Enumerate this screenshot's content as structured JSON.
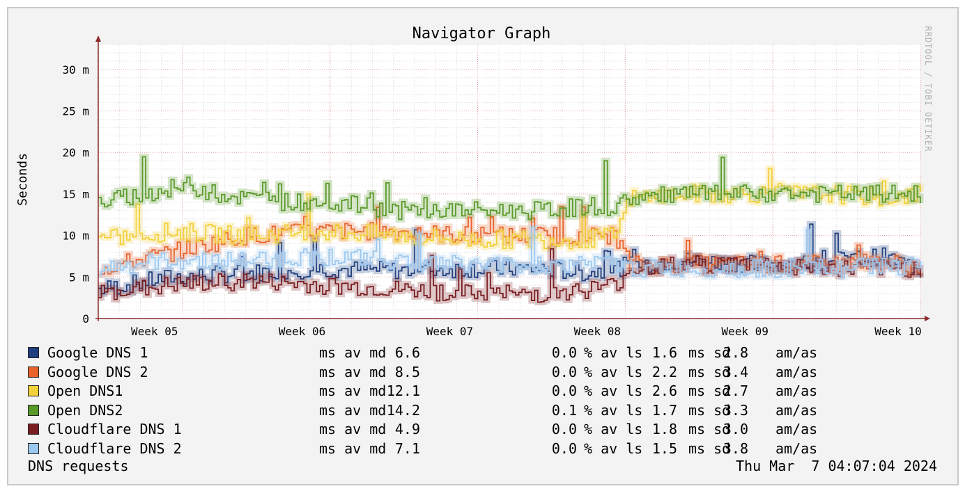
{
  "chart_data": {
    "type": "line",
    "title": "Navigator Graph",
    "ylabel": "Seconds",
    "xlabel": "",
    "watermark": "RRDTOOL / TOBI OETIKER",
    "y_ticks": [
      "0",
      "5 m",
      "10 m",
      "15 m",
      "20 m",
      "25 m",
      "30 m"
    ],
    "y_tick_values": [
      0,
      5,
      10,
      15,
      20,
      25,
      30
    ],
    "ylim": [
      0,
      33
    ],
    "y_unit": "ms",
    "x_ticks": [
      "Week 05",
      "Week 06",
      "Week 07",
      "Week 08",
      "Week 09",
      "Week 10"
    ],
    "x_tick_values": [
      0.57,
      1.57,
      2.57,
      3.57,
      4.57,
      5.57
    ],
    "xlim": [
      0,
      5.57
    ],
    "grid": true,
    "series": [
      {
        "name": "Google DNS 1",
        "color": "#1f3f7f",
        "x": [
          0,
          0.5,
          1,
          1.5,
          2,
          2.5,
          3,
          3.3,
          3.5,
          3.6,
          4,
          4.5,
          5,
          5.3,
          5.57
        ],
        "values": [
          3.5,
          5,
          5.5,
          6,
          5.8,
          6,
          6,
          5.5,
          6,
          6.5,
          7,
          6.5,
          7,
          7.5,
          6
        ]
      },
      {
        "name": "Google DNS 2",
        "color": "#e8622a",
        "x": [
          0,
          0.5,
          1,
          1.5,
          2,
          2.5,
          3,
          3.3,
          3.5,
          3.6,
          4,
          4.5,
          5,
          5.3,
          5.57
        ],
        "values": [
          6,
          8,
          10,
          10.5,
          10.5,
          10,
          10,
          10,
          10,
          6.5,
          6.5,
          6.5,
          6.5,
          7,
          6
        ]
      },
      {
        "name": "Open DNS1",
        "color": "#f2d13a",
        "x": [
          0,
          0.5,
          1,
          1.5,
          2,
          2.5,
          3,
          3.3,
          3.5,
          3.6,
          4,
          4.5,
          5,
          5.3,
          5.57
        ],
        "values": [
          9.5,
          10.5,
          10,
          10.5,
          10,
          9.5,
          9.5,
          9.5,
          10,
          14.5,
          15,
          15,
          15,
          14.5,
          15
        ]
      },
      {
        "name": "Open DNS2",
        "color": "#5a9a2a",
        "x": [
          0,
          0.3,
          0.6,
          0.8,
          1,
          1.3,
          1.6,
          2,
          2.5,
          3,
          3.3,
          3.5,
          3.6,
          4,
          4.5,
          5,
          5.3,
          5.57
        ],
        "values": [
          14,
          15,
          16,
          15,
          14.5,
          14,
          14,
          13,
          13,
          13,
          13.5,
          13.5,
          14.5,
          15,
          15,
          15,
          15,
          15
        ]
      },
      {
        "name": "Cloudflare DNS 1",
        "color": "#7a1e22",
        "x": [
          0,
          0.5,
          1,
          1.5,
          2,
          2.5,
          3,
          3.3,
          3.5,
          3.6,
          4,
          4.5,
          5,
          5.3,
          5.57
        ],
        "values": [
          3,
          4,
          4.5,
          4,
          3.5,
          3,
          3,
          3.5,
          4,
          6,
          6.5,
          6.5,
          6,
          6,
          6
        ]
      },
      {
        "name": "Cloudflare DNS 2",
        "color": "#9cc8f0",
        "x": [
          0,
          0.5,
          1,
          1.5,
          2,
          2.5,
          3,
          3.3,
          3.5,
          3.6,
          4,
          4.5,
          5,
          5.3,
          5.57
        ],
        "values": [
          6,
          7,
          7,
          7.5,
          7,
          6.5,
          6.5,
          6.5,
          6.5,
          6,
          6,
          6,
          6,
          6.5,
          6
        ]
      }
    ]
  },
  "legend": [
    {
      "name": "Google DNS 1",
      "color": "#1f3f7f",
      "md": "6.6",
      "md_unit": "ms av md",
      "ls": "0.0",
      "ls_unit": "% av ls",
      "sd": "1.6",
      "sd_unit": "ms sd",
      "am": "2.8",
      "am_unit": "am/as"
    },
    {
      "name": "Google DNS 2",
      "color": "#e8622a",
      "md": "8.5",
      "md_unit": "ms av md",
      "ls": "0.0",
      "ls_unit": "% av ls",
      "sd": "2.2",
      "sd_unit": "ms sd",
      "am": "3.4",
      "am_unit": "am/as"
    },
    {
      "name": "Open DNS1",
      "color": "#f2d13a",
      "md": "12.1",
      "md_unit": "ms av md",
      "ls": "0.0",
      "ls_unit": "% av ls",
      "sd": "2.6",
      "sd_unit": "ms sd",
      "am": "2.7",
      "am_unit": "am/as"
    },
    {
      "name": "Open DNS2",
      "color": "#5a9a2a",
      "md": "14.2",
      "md_unit": "ms av md",
      "ls": "0.1",
      "ls_unit": "% av ls",
      "sd": "1.7",
      "sd_unit": "ms sd",
      "am": "3.3",
      "am_unit": "am/as"
    },
    {
      "name": "Cloudflare DNS 1",
      "color": "#7a1e22",
      "md": "4.9",
      "md_unit": "ms av md",
      "ls": "0.0",
      "ls_unit": "% av ls",
      "sd": "1.8",
      "sd_unit": "ms sd",
      "am": "3.0",
      "am_unit": "am/as"
    },
    {
      "name": "Cloudflare DNS 2",
      "color": "#9cc8f0",
      "md": "7.1",
      "md_unit": "ms av md",
      "ls": "0.0",
      "ls_unit": "% av ls",
      "sd": "1.5",
      "sd_unit": "ms sd",
      "am": "3.8",
      "am_unit": "am/as"
    }
  ],
  "footer": {
    "left": "DNS requests",
    "right": "Thu Mar  7 04:07:04 2024"
  }
}
